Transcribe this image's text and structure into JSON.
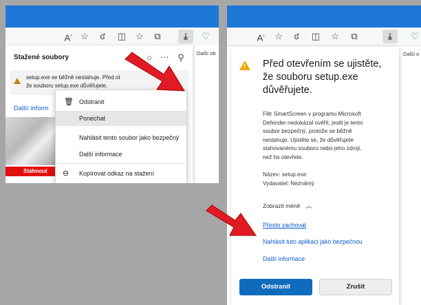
{
  "left": {
    "panel_title": "Stažené soubory",
    "warning_text_line1": "setup.exe se běžně nestahuje. Před ot",
    "warning_text_line2": "že souboru setup.exe důvěřujete.",
    "more_info_partial": "Další inform",
    "download_bar_text": "Stáhnout",
    "toolbar_partial_label": "Další ob",
    "menu": {
      "items": [
        {
          "label": "Odstranit",
          "icon": "trash-icon"
        },
        {
          "label": "Ponechat",
          "icon": ""
        },
        {
          "label": "Nahlásit tento soubor jako bezpečný",
          "icon": ""
        },
        {
          "label": "Další informace",
          "icon": ""
        },
        {
          "label": "Kopírovat odkaz na stažení",
          "icon": "link-icon"
        }
      ]
    }
  },
  "right": {
    "toolbar_partial_label": "Další o",
    "heading": "Před otevřením se ujistěte, že souboru setup.exe důvěřujete.",
    "heading_line1": "Před otevřením se ujistěte,",
    "heading_line2": "že souboru setup.exe",
    "heading_line3": "důvěřujete.",
    "body_lines": [
      "Filtr SmartScreen v programu Microsoft",
      "Defender nedokázal ověřit, jestli je tento",
      "soubor bezpečný, protože se běžně",
      "nestahuje. Ujistěte se, že důvěřujete",
      "stahovanému souboru nebo jeho zdroji,",
      "než ho otevřete."
    ],
    "name_line": "Název: setup.exe",
    "publisher_line": "Vydavatel: Neznámý",
    "show_less": "Zobrazit méně",
    "keep_anyway": "Přesto zachovat",
    "report_safe": "Nahlásit tuto aplikaci jako bezpečnou",
    "more_info": "Další informace",
    "delete_button": "Odstranit",
    "cancel_button": "Zrušit"
  },
  "colors": {
    "accent_blue": "#1e78d8",
    "button_blue": "#0f6cbd",
    "link_blue": "#0b5ec9",
    "arrow_red": "#e01b24",
    "warning_yellow": "#e8a800",
    "download_red": "#e20f0f"
  }
}
